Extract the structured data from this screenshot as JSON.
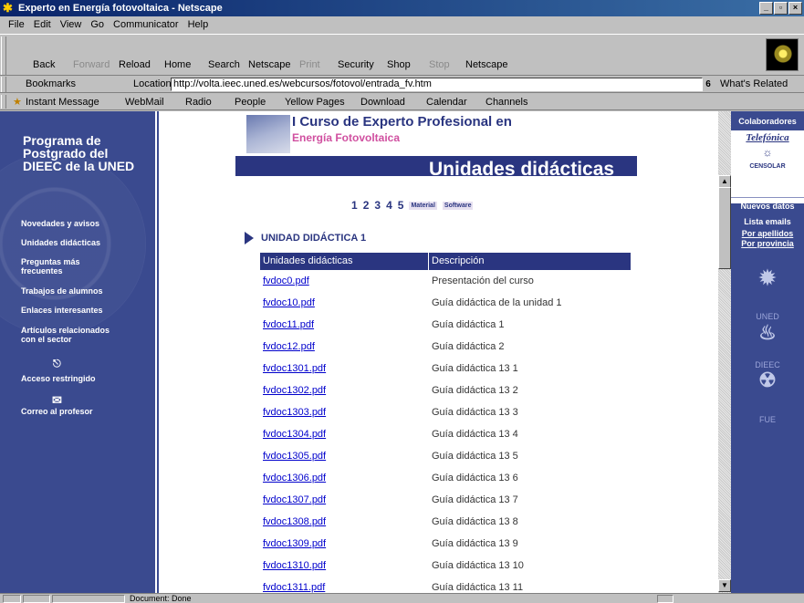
{
  "window": {
    "title": "Experto en Energía fotovoltaica - Netscape"
  },
  "menu": [
    "File",
    "Edit",
    "View",
    "Go",
    "Communicator",
    "Help"
  ],
  "toolbar": {
    "back": "Back",
    "forward": "Forward",
    "reload": "Reload",
    "home": "Home",
    "search": "Search",
    "netscape": "Netscape",
    "print": "Print",
    "security": "Security",
    "shop": "Shop",
    "stop": "Stop",
    "netscape2": "Netscape"
  },
  "location": {
    "bookmarks": "Bookmarks",
    "label": "Location:",
    "url": "http://volta.ieec.uned.es/webcursos/fotovol/entrada_fv.htm",
    "related": "What's Related"
  },
  "personal": [
    "Instant Message",
    "WebMail",
    "Radio",
    "People",
    "Yellow Pages",
    "Download",
    "Calendar",
    "Channels"
  ],
  "leftnav": {
    "program": "Programa de Postgrado del DIEEC de la UNED",
    "items": [
      "Novedades y avisos",
      "Unidades didácticas",
      "Preguntas más frecuentes",
      "Trabajos de alumnos",
      "Enlaces interesantes",
      "Artículos relacionados con el sector",
      "Acceso restringido",
      "Correo al profesor"
    ]
  },
  "content": {
    "course_line1": "I Curso de Experto Profesional en",
    "course_line2": "Energía Fotovoltaica",
    "banner": "Unidades didácticas",
    "pages": [
      "1",
      "2",
      "3",
      "4",
      "5"
    ],
    "links": [
      "Material",
      "Software"
    ],
    "unit_title": "UNIDAD DIDÁCTICA 1",
    "columns": [
      "Unidades didácticas",
      "Descripción"
    ],
    "rows": [
      {
        "file": "fvdoc0.pdf",
        "desc": "Presentación del curso"
      },
      {
        "file": "fvdoc10.pdf",
        "desc": "Guía didáctica de la unidad 1"
      },
      {
        "file": "fvdoc11.pdf",
        "desc": "Guía didáctica 1"
      },
      {
        "file": "fvdoc12.pdf",
        "desc": "Guía didáctica 2"
      },
      {
        "file": "fvdoc1301.pdf",
        "desc": "Guía didáctica 13 1"
      },
      {
        "file": "fvdoc1302.pdf",
        "desc": "Guía didáctica 13 2"
      },
      {
        "file": "fvdoc1303.pdf",
        "desc": "Guía didáctica 13 3"
      },
      {
        "file": "fvdoc1304.pdf",
        "desc": "Guía didáctica 13 4"
      },
      {
        "file": "fvdoc1305.pdf",
        "desc": "Guía didáctica 13 5"
      },
      {
        "file": "fvdoc1306.pdf",
        "desc": "Guía didáctica 13 6"
      },
      {
        "file": "fvdoc1307.pdf",
        "desc": "Guía didáctica 13 7"
      },
      {
        "file": "fvdoc1308.pdf",
        "desc": "Guía didáctica 13 8"
      },
      {
        "file": "fvdoc1309.pdf",
        "desc": "Guía didáctica 13 9"
      },
      {
        "file": "fvdoc1310.pdf",
        "desc": "Guía didáctica 13 10"
      },
      {
        "file": "fvdoc1311.pdf",
        "desc": "Guía didáctica 13 11"
      }
    ]
  },
  "rightnav": {
    "collab": "Colaboradores",
    "telefonica": "Telefónica",
    "consolar": "CENSOLAR",
    "nuevos": "Nuevos datos",
    "lista": "Lista emails",
    "por_apellidos": "Por apellidos",
    "por_provincia": "Por provincia",
    "uned": "UNED",
    "dieec": "DIEEC",
    "fue": "FUE"
  },
  "status": {
    "text": "Document: Done"
  }
}
